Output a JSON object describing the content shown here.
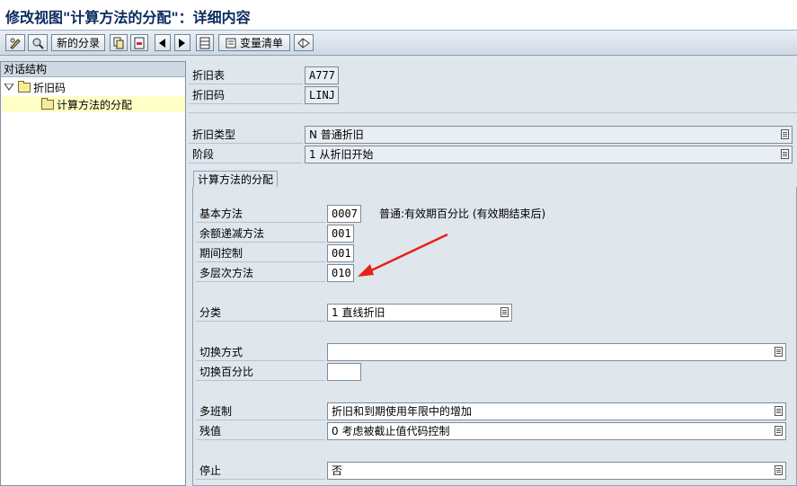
{
  "window": {
    "title": "修改视图\"计算方法的分配\"：详细内容"
  },
  "toolbar": {
    "new_entries": "新的分录",
    "variable_list": "变量清单"
  },
  "tree": {
    "header": "对话结构",
    "node_depreciation_key": "折旧码",
    "node_assignment": "计算方法的分配"
  },
  "keys": {
    "chart_of_dep_label": "折旧表",
    "chart_of_dep_value": "A777",
    "dep_key_label": "折旧码",
    "dep_key_value": "LINJ"
  },
  "header_fields": {
    "dep_type_label": "折旧类型",
    "dep_type_value": "N 普通折旧",
    "phase_label": "阶段",
    "phase_value": "1 从折旧开始"
  },
  "group": {
    "tab_label": "计算方法的分配",
    "base_method_label": "基本方法",
    "base_method_value": "0007",
    "base_method_desc": "普通:有效期百分比 (有效期结束后)",
    "declining_balance_label": "余额递减方法",
    "declining_balance_value": "001",
    "period_control_label": "期间控制",
    "period_control_value": "001",
    "multilevel_label": "多层次方法",
    "multilevel_value": "010",
    "class_label": "分类",
    "class_value": "1 直线折旧",
    "changeover_method_label": "切换方式",
    "changeover_method_value": "",
    "changeover_pct_label": "切换百分比",
    "changeover_pct_value": "",
    "multishift_label": "多班制",
    "multishift_value": "折旧和到期使用年限中的增加",
    "scrap_value_label": "残值",
    "scrap_value_value": "0 考虑被截止值代码控制",
    "shutdown_label": "停止",
    "shutdown_value": "否"
  },
  "annotation": {
    "arrow_color": "#e8201a"
  }
}
